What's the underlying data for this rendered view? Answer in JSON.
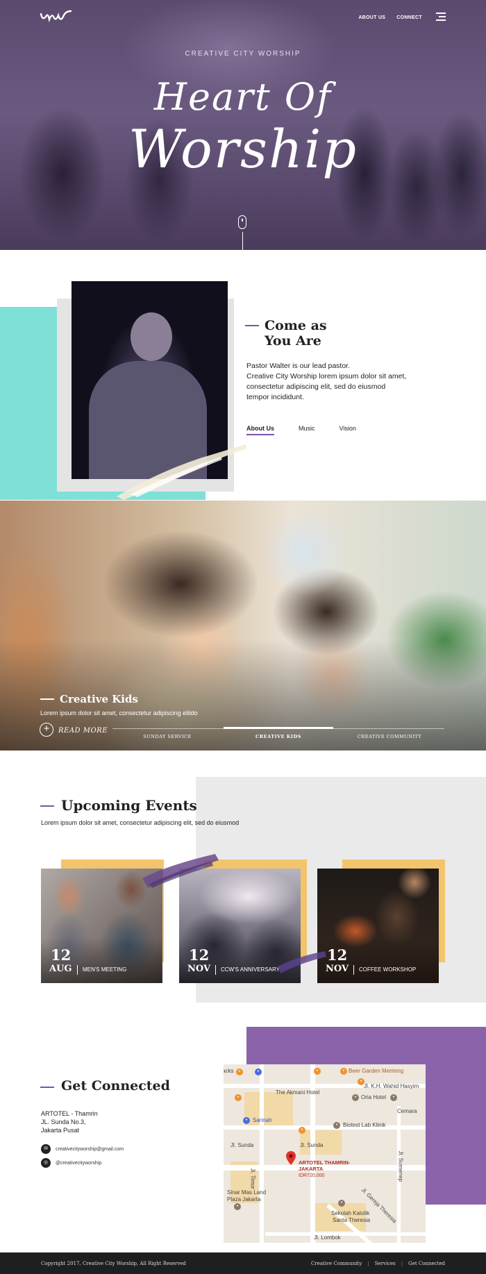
{
  "nav": {
    "about": "ABOUT US",
    "connect": "CONNECT"
  },
  "hero": {
    "eyebrow": "CREATIVE CITY WORSHIP",
    "title_line1": "Heart Of",
    "title_line2": "Worship"
  },
  "about": {
    "heading_line1": "Come as",
    "heading_line2": "You Are",
    "paragraph_line1": "Pastor Walter is our lead pastor.",
    "paragraph_line2": "Creative City Worship lorem ipsum dolor sit amet,",
    "paragraph_line3": "consectetur adipiscing elit, sed do eiusmod",
    "paragraph_line4": "tempor incididunt.",
    "tabs": [
      "About Us",
      "Music",
      "Vision"
    ],
    "active_tab": "About Us",
    "accent_color": "#7b52ab",
    "teal_color": "#7fe0d8"
  },
  "kids": {
    "title": "Creative Kids",
    "subtitle": "Lorem ipsum dolor sit amet, consectetur adipiscing elitdo",
    "read_more": "READ MORE",
    "slides": [
      "SUNDAY SERVICE",
      "CREATIVE KIDS",
      "CREATIVE COMMUNITY"
    ],
    "active_slide": "CREATIVE KIDS"
  },
  "events": {
    "title": "Upcoming Events",
    "subtitle": "Lorem ipsum dolor sit amet, consectetur adipiscing elit, sed do eiusmod",
    "items": [
      {
        "day": "12",
        "month": "AUG",
        "title": "MEN'S MEETING"
      },
      {
        "day": "12",
        "month": "NOV",
        "title": "CCW'S ANNIVERSARY"
      },
      {
        "day": "12",
        "month": "NOV",
        "title": "COFFEE WORKSHOP"
      }
    ],
    "card_accent": "#f2c46c"
  },
  "connect": {
    "title": "Get Connected",
    "address_line1": "ARTOTEL - Thamrin",
    "address_line2": "JL. Sunda No.3,",
    "address_line3": "Jakarta Pusat",
    "email": "creativecityworship@gmail.com",
    "instagram": "@creativecityworship",
    "purple": "#8a63ab"
  },
  "map": {
    "labels": {
      "beer": "Beer Garden Menteng",
      "wahid": "Jl. K.H. Wahid Hasyim",
      "akmani": "The Akmani Hotel",
      "oria": "Oria Hotel",
      "cemara": "Cemara",
      "sarinah": "Sarinah",
      "biotest": "Biotest Lab Klinik",
      "sunda": "Jl. Sunda",
      "sunda2": "Jl. Sunda",
      "timor": "Jl. Timor",
      "sumenep": "Jl. Sumenep",
      "pin_name": "ARTOTEL THAMRIN-JAKARTA",
      "pin_price": "IDR720,000",
      "sinar_line1": "Sinar Mas Land",
      "sinar_line2": "Plaza Jakarta",
      "theresia": "Jl. Gereja Theresia",
      "sekolah_line1": "Sekolah Katolik",
      "sekolah_line2": "Santa Theresia",
      "lombok": "Jl. Lombok",
      "acks": "acks"
    }
  },
  "footer": {
    "copyright": "Copyright 2017, Creative City Worship, All Right Reserved",
    "links": [
      "Creative Community",
      "Services",
      "Get Connected"
    ],
    "separator": "|"
  }
}
